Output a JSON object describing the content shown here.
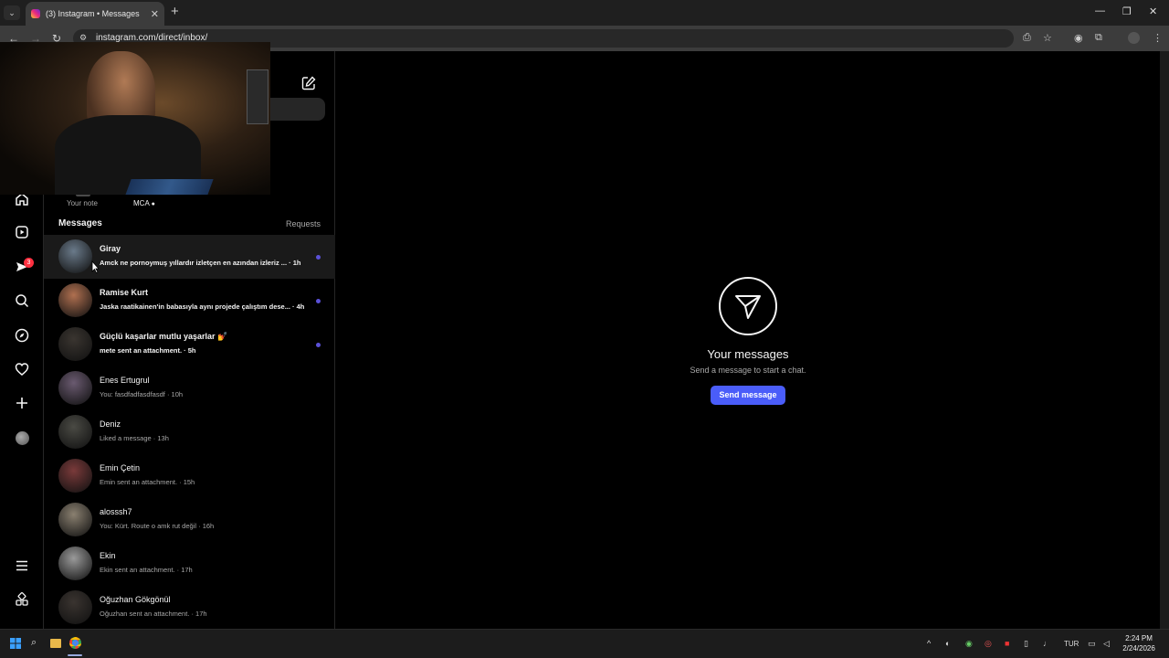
{
  "browser": {
    "tab_title": "(3) Instagram • Messages",
    "url": "instagram.com/direct/inbox/"
  },
  "nav": {
    "notification_count": "3"
  },
  "notes": {
    "your_note": "Your note",
    "mca": "MCA"
  },
  "list": {
    "heading": "Messages",
    "requests": "Requests",
    "conversations": [
      {
        "name": "Giray",
        "preview": "Amck ne pornoymuş yıllardır izletçen en azından izleriz ... · 1h",
        "unread": true,
        "highlight": true,
        "avatar": "#6a7a8a"
      },
      {
        "name": "Ramise Kurt",
        "preview": "Jaska raatikainen'in babasıyla aynı projede çalıştım dese... · 4h",
        "unread": true,
        "highlight": false,
        "avatar": "#b07050"
      },
      {
        "name": "Güçlü kaşarlar mutlu yaşarlar 💅",
        "preview": "mete sent an attachment. · 5h",
        "unread": true,
        "highlight": false,
        "avatar": "#3a3530"
      },
      {
        "name": "Enes Ertugrul",
        "preview": "You: fasdfadfasdfasdf · 10h",
        "unread": false,
        "highlight": false,
        "avatar": "#6a5a70"
      },
      {
        "name": "Deniz",
        "preview": "Liked a message · 13h",
        "unread": false,
        "highlight": false,
        "avatar": "#4a4a44"
      },
      {
        "name": "Emin Çetin",
        "preview": "Emin sent an attachment. · 15h",
        "unread": false,
        "highlight": false,
        "avatar": "#7a3a3a"
      },
      {
        "name": "alosssh7",
        "preview": "You: Kürt. Route o amk rut değil · 16h",
        "unread": false,
        "highlight": false,
        "avatar": "#8a8070"
      },
      {
        "name": "Ekin",
        "preview": "Ekin sent an attachment. · 17h",
        "unread": false,
        "highlight": false,
        "avatar": "#9a9a9a"
      },
      {
        "name": "Oğuzhan Gökgönül",
        "preview": "Oğuzhan sent an attachment. · 17h",
        "unread": false,
        "highlight": false,
        "avatar": "#3a3430"
      }
    ]
  },
  "empty": {
    "title": "Your messages",
    "subtitle": "Send a message to start a chat.",
    "button": "Send message"
  },
  "taskbar": {
    "lang": "TUR",
    "time": "2:24 PM",
    "date": "2/24/2026"
  },
  "colors": {
    "accent": "#4a5df9",
    "unread_dot": "#5b51d8",
    "badge": "#ff3040"
  }
}
